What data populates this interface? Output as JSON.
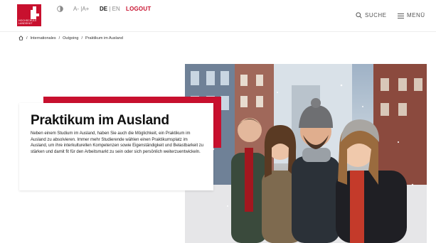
{
  "header": {
    "logo_alt": "Hochschule Landshut",
    "logo_text_line1": "HOCHSCHULE",
    "logo_text_line2": "LANDSHUT",
    "contrast_icon": "contrast-icon",
    "font_smaller": "A-",
    "font_separator": "|",
    "font_larger": "A+",
    "lang_de": "DE",
    "lang_separator": "|",
    "lang_en": "EN",
    "logout": "LOGOUT",
    "search_label": "SUCHE",
    "menu_label": "MENÜ"
  },
  "breadcrumb": {
    "home_icon": "home-icon",
    "items": [
      "Internationales",
      "Outgoing",
      "Praktikum im Ausland"
    ],
    "separator": "/"
  },
  "hero": {
    "title": "Praktikum im Ausland",
    "text": "Neben einem Studium im Ausland, haben Sie auch die Möglichkeit, ein Praktikum im Ausland zu absolvieren. Immer mehr Studierende wählen einen Praktikumsplatz im Ausland, um ihre interkulturellen Kompetenzen sowie Eigenständigkeit und Belastbarkeit zu stärken und damit fit für den Arbeitsmarkt zu sein oder sich persönlich weiterzuentwickeln.",
    "image_desc": "students-winter-street-photo"
  },
  "colors": {
    "accent": "#c8102e"
  }
}
